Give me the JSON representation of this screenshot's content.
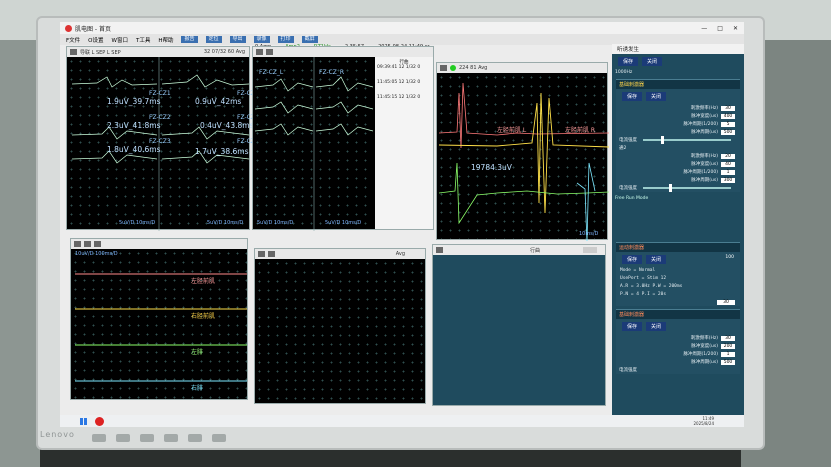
{
  "window": {
    "title": "肌电图 - 首页",
    "minimize": "—",
    "maximize": "□",
    "close": "✕"
  },
  "menu": {
    "items": [
      "F文件",
      "O设置",
      "W窗口",
      "T工具",
      "H帮助"
    ],
    "tools": [
      "报告",
      "定位",
      "导出",
      "录像",
      "打印",
      "截屏"
    ]
  },
  "status": {
    "amp": "0 Amp",
    "ampf": "Amp2",
    "rate": "RZ1kls",
    "clock": "2 35:57",
    "datetime": "2025-08-24 11:49 sr",
    "right_title": "听诱发生"
  },
  "panels": {
    "p1": {
      "header": "导联 L SEP L SEP",
      "toolbar_count": "32 07/32 60 Avg",
      "labels": [
        {
          "ch": "FZ-CZ1",
          "text": "1.9uV_39.7ms"
        },
        {
          "ch": "FZ-CZ1",
          "text": "0.9uV_42ms"
        },
        {
          "ch": "FZ-CZ2",
          "text": "2.3uV_41.8ms"
        },
        {
          "ch": "FZ-CZ2",
          "text": "0.4uV_43.8ms"
        },
        {
          "ch": "FZ-CZ3",
          "text": "1.8uV_40.6ms"
        },
        {
          "ch": "FZ-CZ3",
          "text": "1.7uV_38.6ms"
        }
      ],
      "scale_left": "5uV/D  10ms/D",
      "scale_right": "5uV/D  10ms/D"
    },
    "p2": {
      "labels": [
        "FZ-CZ_L",
        "FZ-CZ_R"
      ],
      "rows": [
        "09:39:41 12 1/32 0",
        "11:45:05 12 1/32 0",
        "11:45:15 12 1/32 0"
      ],
      "row_hdr": "行曲",
      "scale_left": "5uV/D 10ms/D",
      "scale_right": "5uV/D 10ms/D"
    },
    "p3": {
      "count": "224 81 Avg",
      "label": "左胫前肌 L",
      "label2": "左胫前肌 R",
      "big": "19784.3uV",
      "scale": "10ms/D"
    },
    "p4": {
      "scale": "10uV/D  100ms/D",
      "channels": [
        "左胫前肌",
        "右胫前肌",
        "左腓",
        "右腓"
      ],
      "colors": [
        "#ff8a8a",
        "#ffe14a",
        "#8cff6a",
        "#7de8ff"
      ]
    },
    "p5": {
      "avg": "Avg"
    },
    "p6": {
      "row_hdr": "行曲"
    }
  },
  "right": {
    "top_freq": "1000Hz",
    "save_label": "保存",
    "close_label": "关闭",
    "sec1_title": "基础刺激器",
    "sec1_rows": [
      {
        "name": "刺激频率(Hz)",
        "val": "30",
        "unit": ""
      },
      {
        "name": "脉冲宽度(us)",
        "val": "400",
        "unit": ""
      },
      {
        "name": "脉冲周期(1/200)",
        "val": "5",
        "unit": ""
      },
      {
        "name": "脉冲周期(us)",
        "val": "500",
        "unit": ""
      }
    ],
    "sec1_extra": "电流强度",
    "sec2_label": "通2",
    "sec2_rows": [
      {
        "name": "刺激频率(Hz)",
        "val": "20",
        "unit": ""
      },
      {
        "name": "脉冲宽度(us)",
        "val": "40",
        "unit": ""
      },
      {
        "name": "脉冲周期(1/200)",
        "val": "1",
        "unit": ""
      },
      {
        "name": "脉冲周期(us)",
        "val": "300",
        "unit": ""
      }
    ],
    "sec2_extra": "电流强度",
    "mid_label": "Free Run  Mode",
    "sec3_title": "运动刺激器",
    "sec3_lines": [
      "Mode = Normal",
      "UsePort = Stim 12",
      "A.R = 3.0Hz  P.W = 200ms",
      "P.N = 4  P.I = 20s"
    ],
    "sec3_val": "100",
    "sec3_ma": "30",
    "sec4_title": "基础刺激器",
    "sec4_rows": [
      {
        "name": "刺激频率(Hz)",
        "val": "30",
        "unit": ""
      },
      {
        "name": "脉冲宽度(us)",
        "val": "200",
        "unit": ""
      },
      {
        "name": "脉冲周期(1/200)",
        "val": "1",
        "unit": ""
      },
      {
        "name": "脉冲周期(us)",
        "val": "500",
        "unit": ""
      }
    ],
    "sec4_extra": "电流强度"
  },
  "taskbar": {
    "time": "11:49",
    "date": "2025/8/24"
  },
  "monitor": {
    "brand": "Lenovo"
  }
}
